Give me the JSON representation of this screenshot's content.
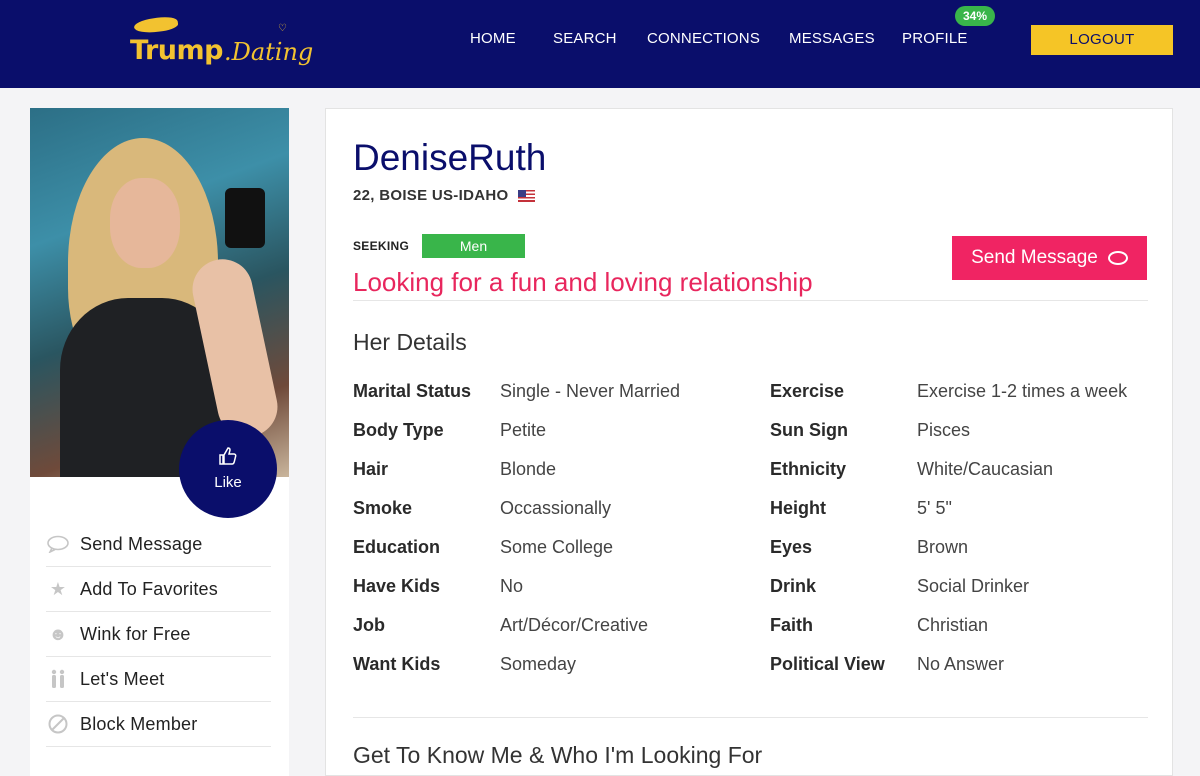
{
  "header": {
    "logo": {
      "brand": "Trump",
      "suffix": ".Dating"
    },
    "nav": [
      {
        "label": "HOME"
      },
      {
        "label": "SEARCH"
      },
      {
        "label": "CONNECTIONS"
      },
      {
        "label": "MESSAGES"
      },
      {
        "label": "PROFILE"
      }
    ],
    "profile_completion": "34%",
    "profile_completion_fraction": 0.34,
    "logout_label": "LOGOUT"
  },
  "sidebar": {
    "like_label": "Like",
    "like_icon": "thumbs-up-icon",
    "actions": [
      {
        "label": "Send Message",
        "icon": "speech-bubble-icon"
      },
      {
        "label": "Add To Favorites",
        "icon": "star-icon"
      },
      {
        "label": "Wink for Free",
        "icon": "smiley-icon"
      },
      {
        "label": "Let's Meet",
        "icon": "couple-icon"
      },
      {
        "label": "Block Member",
        "icon": "block-icon"
      }
    ]
  },
  "profile": {
    "username": "DeniseRuth",
    "location": "22, BOISE US-IDAHO",
    "flag_icon": "us-flag-icon",
    "seeking_label": "SEEKING",
    "seeking_value": "Men",
    "tagline": "Looking for a fun and loving relationship",
    "send_message_label": "Send Message"
  },
  "details": {
    "title": "Her Details",
    "left": [
      {
        "key": "Marital Status",
        "value": "Single - Never Married"
      },
      {
        "key": "Body Type",
        "value": "Petite"
      },
      {
        "key": "Hair",
        "value": "Blonde"
      },
      {
        "key": "Smoke",
        "value": "Occassionally"
      },
      {
        "key": "Education",
        "value": "Some College"
      },
      {
        "key": "Have Kids",
        "value": "No"
      },
      {
        "key": "Job",
        "value": "Art/Décor/Creative"
      },
      {
        "key": "Want Kids",
        "value": "Someday"
      }
    ],
    "right": [
      {
        "key": "Exercise",
        "value": "Exercise 1-2 times a week"
      },
      {
        "key": "Sun Sign",
        "value": "Pisces"
      },
      {
        "key": "Ethnicity",
        "value": "White/Caucasian"
      },
      {
        "key": "Height",
        "value": "5' 5\""
      },
      {
        "key": "Eyes",
        "value": "Brown"
      },
      {
        "key": "Drink",
        "value": "Social Drinker"
      },
      {
        "key": "Faith",
        "value": "Christian"
      },
      {
        "key": "Political View",
        "value": "No Answer"
      }
    ]
  },
  "about": {
    "title": "Get To Know Me & Who I'm Looking For"
  },
  "colors": {
    "header_bg": "#0a0e6b",
    "accent_yellow": "#f5c526",
    "accent_pink": "#f02463",
    "tagline_pink": "#e8265d",
    "badge_green": "#39b54a"
  }
}
